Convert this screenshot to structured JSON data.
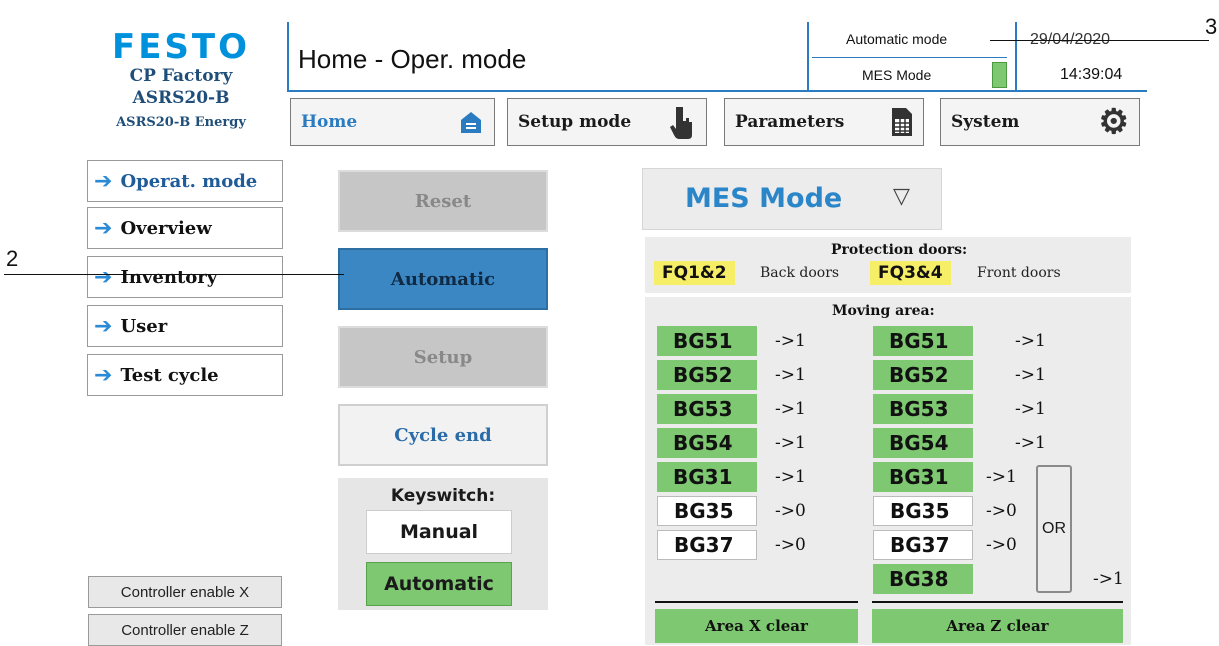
{
  "logo": {
    "brand": "FESTO",
    "line1": "CP Factory",
    "line2": "ASRS20-B",
    "line3": "ASRS20-B Energy"
  },
  "header": {
    "title": "Home - Oper. mode",
    "mode_label": "Automatic mode",
    "date": "29/04/2020",
    "mes_label": "MES Mode",
    "time": "14:39:04",
    "mes_indicator_color": "#7dc870"
  },
  "nav": {
    "tabs": [
      {
        "label": "Home",
        "icon": "house-icon"
      },
      {
        "label": "Setup mode",
        "icon": "hand-pointer-icon"
      },
      {
        "label": "Parameters",
        "icon": "document-table-icon"
      },
      {
        "label": "System",
        "icon": "gear-icon"
      }
    ]
  },
  "sidebar": {
    "items": [
      {
        "label": "Operat. mode"
      },
      {
        "label": "Overview"
      },
      {
        "label": "Inventory"
      },
      {
        "label": "User"
      },
      {
        "label": "Test cycle"
      }
    ]
  },
  "controls": {
    "enable_x": "Controller enable X",
    "enable_z": "Controller enable Z"
  },
  "mode_buttons": {
    "reset": "Reset",
    "automatic": "Automatic",
    "setup": "Setup",
    "cycle_end": "Cycle end"
  },
  "keyswitch": {
    "title": "Keyswitch:",
    "manual": "Manual",
    "automatic": "Automatic"
  },
  "mes_dropdown": {
    "value": "MES Mode",
    "chevron": "▽"
  },
  "protection": {
    "title": "Protection doors:",
    "left_tag": "FQ1&2",
    "left_desc": "Back doors",
    "right_tag": "FQ3&4",
    "right_desc": "Front doors"
  },
  "moving": {
    "title": "Moving area:",
    "left": [
      {
        "name": "BG51",
        "val": "->1",
        "state": "green"
      },
      {
        "name": "BG52",
        "val": "->1",
        "state": "green"
      },
      {
        "name": "BG53",
        "val": "->1",
        "state": "green"
      },
      {
        "name": "BG54",
        "val": "->1",
        "state": "green"
      },
      {
        "name": "BG31",
        "val": "->1",
        "state": "green"
      },
      {
        "name": "BG35",
        "val": "->0",
        "state": "white"
      },
      {
        "name": "BG37",
        "val": "->0",
        "state": "white"
      }
    ],
    "right": [
      {
        "name": "BG51",
        "val": "->1",
        "state": "green"
      },
      {
        "name": "BG52",
        "val": "->1",
        "state": "green"
      },
      {
        "name": "BG53",
        "val": "->1",
        "state": "green"
      },
      {
        "name": "BG54",
        "val": "->1",
        "state": "green"
      },
      {
        "name": "BG31",
        "val": "->1",
        "state": "green"
      },
      {
        "name": "BG35",
        "val": "->0",
        "state": "white"
      },
      {
        "name": "BG37",
        "val": "->0",
        "state": "white"
      },
      {
        "name": "BG38",
        "val": "->1",
        "state": "green"
      }
    ],
    "or_label": "OR",
    "area_x": "Area X clear",
    "area_z": "Area Z clear"
  },
  "annotations": {
    "a2": "2",
    "a3": "3"
  }
}
